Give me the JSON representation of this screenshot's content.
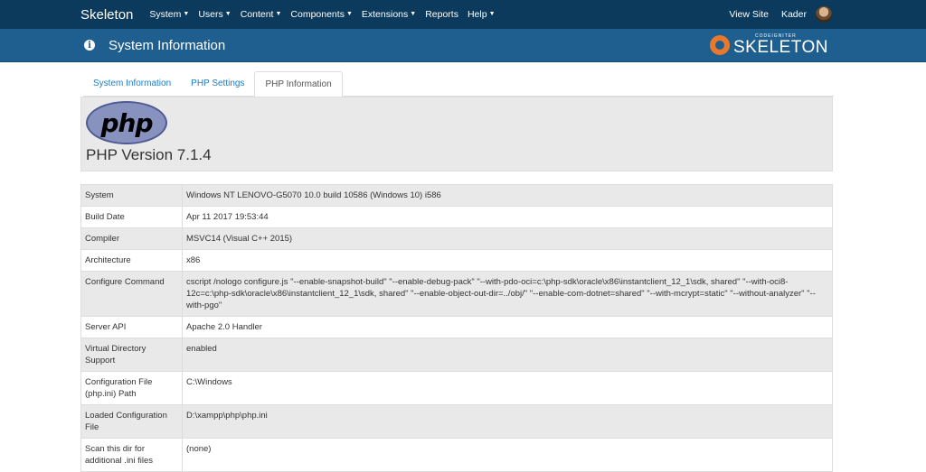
{
  "topnav": {
    "brand": "Skeleton",
    "menu": [
      {
        "label": "System",
        "caret": true
      },
      {
        "label": "Users",
        "caret": true
      },
      {
        "label": "Content",
        "caret": true
      },
      {
        "label": "Components",
        "caret": true
      },
      {
        "label": "Extensions",
        "caret": true
      },
      {
        "label": "Reports",
        "caret": false
      },
      {
        "label": "Help",
        "caret": true
      }
    ],
    "view_site": "View Site",
    "user": "Kader"
  },
  "header": {
    "title": "System Information",
    "logo_small": "CODEIGNITER",
    "logo_big": "SKELETON"
  },
  "tabs": [
    "System Information",
    "PHP Settings",
    "PHP Information"
  ],
  "php": {
    "logo_text": "php",
    "version": "PHP Version 7.1.4"
  },
  "rows": [
    {
      "key": "System",
      "value": "Windows NT LENOVO-G5070 10.0 build 10586 (Windows 10) i586"
    },
    {
      "key": "Build Date",
      "value": "Apr 11 2017 19:53:44"
    },
    {
      "key": "Compiler",
      "value": "MSVC14 (Visual C++ 2015)"
    },
    {
      "key": "Architecture",
      "value": "x86"
    },
    {
      "key": "Configure Command",
      "value": "cscript /nologo configure.js \"--enable-snapshot-build\" \"--enable-debug-pack\" \"--with-pdo-oci=c:\\php-sdk\\oracle\\x86\\instantclient_12_1\\sdk, shared\" \"--with-oci8-12c=c:\\php-sdk\\oracle\\x86\\instantclient_12_1\\sdk, shared\" \"--enable-object-out-dir=../obj/\" \"--enable-com-dotnet=shared\" \"--with-mcrypt=static\" \"--without-analyzer\" \"--with-pgo\""
    },
    {
      "key": "Server API",
      "value": "Apache 2.0 Handler"
    },
    {
      "key": "Virtual Directory Support",
      "value": "enabled"
    },
    {
      "key": "Configuration File (php.ini) Path",
      "value": "C:\\Windows"
    },
    {
      "key": "Loaded Configuration File",
      "value": "D:\\xampp\\php\\php.ini"
    },
    {
      "key": "Scan this dir for additional .ini files",
      "value": "(none)"
    }
  ]
}
